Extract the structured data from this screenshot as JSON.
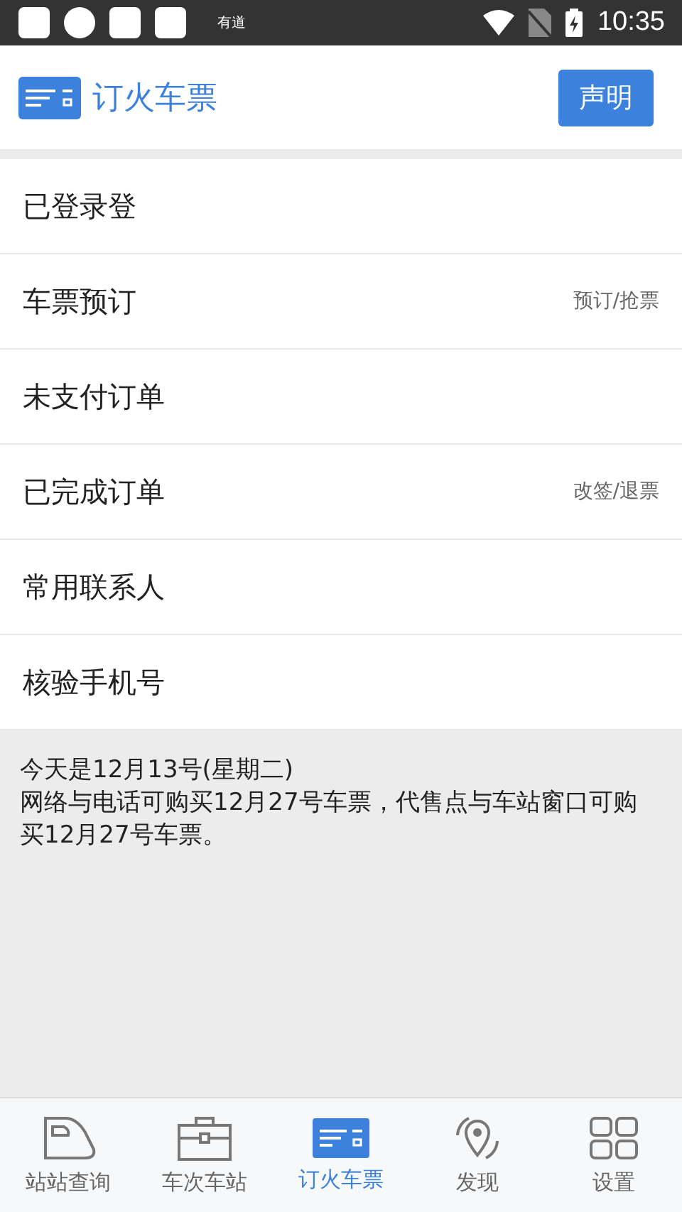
{
  "status_bar": {
    "app_label": "有道",
    "time": "10:35"
  },
  "header": {
    "title": "订火车票",
    "button": "声明"
  },
  "menu": [
    {
      "label": "已登录登"
    },
    {
      "label": "车票预订",
      "hint": "预订/抢票"
    },
    {
      "label": "未支付订单"
    },
    {
      "label": "已完成订单",
      "hint": "改签/退票"
    },
    {
      "label": "常用联系人"
    },
    {
      "label": "核验手机号"
    }
  ],
  "notice": [
    "今天是12月13号(星期二)",
    "网络与电话可购买12月27号车票，代售点与车站窗口可购买12月27号车票。"
  ],
  "bottom_nav": [
    {
      "label": "站站查询",
      "kind": "train",
      "selected": false
    },
    {
      "label": "车次车站",
      "kind": "case",
      "selected": false
    },
    {
      "label": "订火车票",
      "kind": "ticket",
      "selected": true
    },
    {
      "label": "发现",
      "kind": "discover",
      "selected": false
    },
    {
      "label": "设置",
      "kind": "grid",
      "selected": false
    }
  ]
}
